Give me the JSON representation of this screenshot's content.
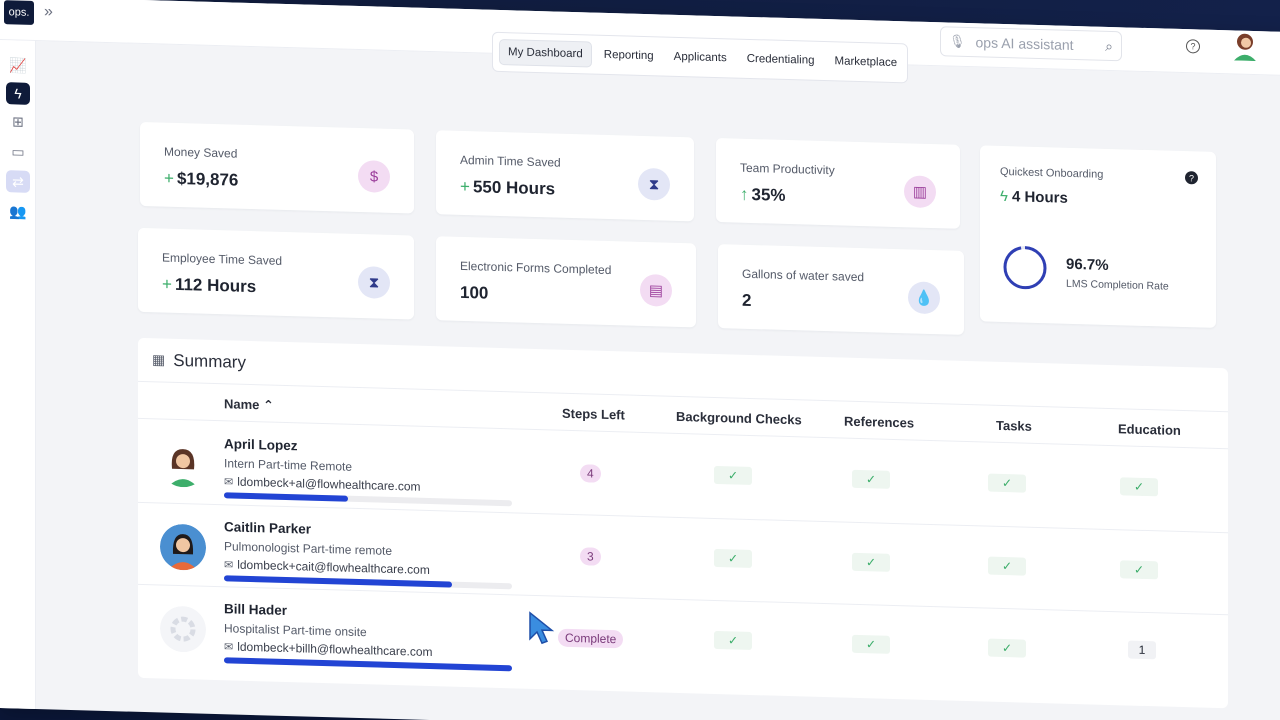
{
  "app": {
    "logo_text": "ops.",
    "search_placeholder": "ops AI assistant",
    "brand_accent": "#2244d4",
    "brand_dark": "#0f1b3a"
  },
  "sidebar": {
    "icons": [
      "chart-icon",
      "bolt-icon",
      "org-chart-icon",
      "onboarding-icon",
      "handshake-icon",
      "team-icon"
    ],
    "active_index": 1
  },
  "tabs": [
    {
      "label": "My Dashboard",
      "active": true
    },
    {
      "label": "Reporting",
      "active": false
    },
    {
      "label": "Applicants",
      "active": false
    },
    {
      "label": "Credentialing",
      "active": false
    },
    {
      "label": "Marketplace",
      "active": false
    }
  ],
  "cards": {
    "money_saved": {
      "label": "Money Saved",
      "prefix": "+",
      "value": "$19,876",
      "icon": "money-bag-icon"
    },
    "admin_time": {
      "label": "Admin Time Saved",
      "prefix": "+",
      "value": "550 Hours",
      "icon": "hourglass-icon"
    },
    "team_productivity": {
      "label": "Team Productivity",
      "prefix": "↑",
      "value": "35%",
      "icon": "bar-chart-icon"
    },
    "employee_time": {
      "label": "Employee Time Saved",
      "prefix": "+",
      "value": "112 Hours",
      "icon": "hourglass-icon"
    },
    "forms_completed": {
      "label": "Electronic Forms Completed",
      "value": "100",
      "icon": "document-icon"
    },
    "water_saved": {
      "label": "Gallons of water saved",
      "value": "2",
      "icon": "water-drop-icon"
    },
    "quickest_onboarding": {
      "label": "Quickest Onboarding",
      "value": "4 Hours",
      "lms_value": "96.7%",
      "lms_label": "LMS Completion Rate",
      "lms_fraction": 0.967
    }
  },
  "summary": {
    "title": "Summary",
    "columns": {
      "name": "Name",
      "steps": "Steps Left",
      "background": "Background Checks",
      "references": "References",
      "tasks": "Tasks",
      "education": "Education"
    },
    "rows": [
      {
        "name": "April Lopez",
        "role": "Intern Part-time Remote",
        "email": "ldombeck+al@flowhealthcare.com",
        "steps_left": "4",
        "progress": 0.43,
        "education": "✓"
      },
      {
        "name": "Caitlin Parker",
        "role": "Pulmonologist Part-time remote",
        "email": "ldombeck+cait@flowhealthcare.com",
        "steps_left": "3",
        "progress": 0.79,
        "education": "✓"
      },
      {
        "name": "Bill Hader",
        "role": "Hospitalist Part-time onsite",
        "email": "ldombeck+billh@flowhealthcare.com",
        "steps_left": "Complete",
        "progress": 1.0,
        "education": "1"
      }
    ],
    "check_glyph": "✓"
  }
}
